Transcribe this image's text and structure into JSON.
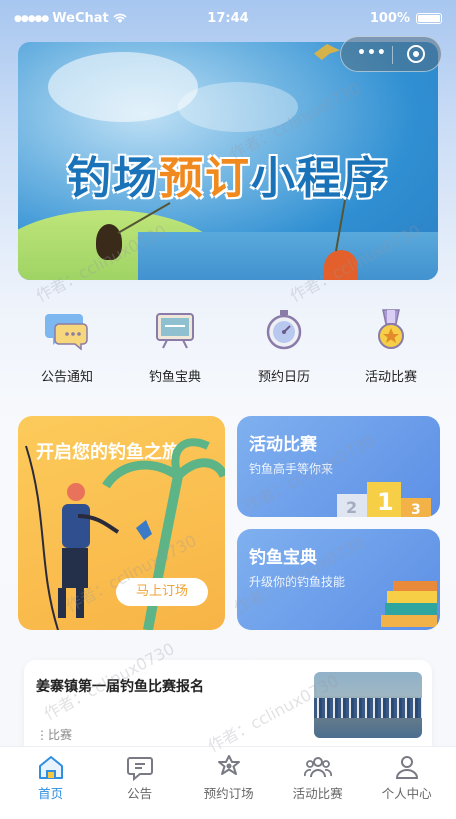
{
  "status": {
    "carrier": "WeChat",
    "time": "17:44",
    "battery": "100%"
  },
  "banner": {
    "title_part1": "钓场",
    "title_highlight": "预订",
    "title_part2": "小程序"
  },
  "shortcuts": [
    {
      "label": "公告通知",
      "icon": "announcement-bubble-icon"
    },
    {
      "label": "钓鱼宝典",
      "icon": "blackboard-icon"
    },
    {
      "label": "预约日历",
      "icon": "stopwatch-icon"
    },
    {
      "label": "活动比赛",
      "icon": "medal-icon"
    }
  ],
  "cards": {
    "journey": {
      "title": "开启您的钓鱼之旅",
      "button": "马上订场"
    },
    "contest": {
      "title": "活动比赛",
      "subtitle": "钓鱼高手等你来"
    },
    "guide": {
      "title": "钓鱼宝典",
      "subtitle": "升级你的钓鱼技能"
    }
  },
  "news": {
    "title": "姜寨镇第一届钓鱼比赛报名",
    "tag": "比赛"
  },
  "tabs": [
    {
      "label": "首页",
      "icon": "home-icon",
      "active": true
    },
    {
      "label": "公告",
      "icon": "message-icon",
      "active": false
    },
    {
      "label": "预约订场",
      "icon": "star-badge-icon",
      "active": false
    },
    {
      "label": "活动比赛",
      "icon": "team-icon",
      "active": false
    },
    {
      "label": "个人中心",
      "icon": "user-icon",
      "active": false
    }
  ],
  "watermark": "作者：cclinux0730",
  "colors": {
    "accent": "#2f8fe0",
    "card_orange": "#f8b446",
    "card_blue": "#5d8fe6"
  }
}
